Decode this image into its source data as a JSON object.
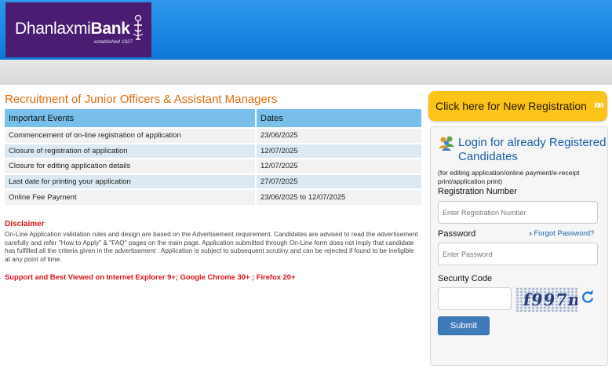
{
  "header": {
    "logo_name_light": "Dhanlaxmi",
    "logo_name_bold": "Bank",
    "logo_tagline": "established 1927",
    "bg_color": "#1a86e2",
    "logo_bg": "#4a1d73"
  },
  "main": {
    "title": "Recruitment of Junior Officers & Assistant Managers",
    "table": {
      "headers": [
        "Important Events",
        "Dates"
      ],
      "rows": [
        [
          "Commencement of on-line registration of application",
          "23/06/2025"
        ],
        [
          "Closure of registration of application",
          "12/07/2025"
        ],
        [
          "Closure for editing application details",
          "12/07/2025"
        ],
        [
          "Last date for printing your application",
          "27/07/2025"
        ],
        [
          "Online Fee Payment",
          "23/06/2025 to 12/07/2025"
        ]
      ]
    },
    "disclaimer_title": "Disclaimer",
    "disclaimer_text": "On-Line Application validation rules and design are based on the Advertisement requirement. Candidates are advised to read the advertisement carefully and refer \"How to Apply\" & \"FAQ\" pages on the main page. Application submitted through On-Line form does not imply that candidate has fulfilled all the criteria given in the advertisement . Application is subject to subsequent scrutiny and can be rejected if found to be ineligible at any point of time.",
    "support_text": "Support and Best Viewed on Internet Explorer 9+; Google Chrome 30+ ; Firefox 20+"
  },
  "sidebar": {
    "new_registration_label": "Click here for New Registration",
    "login_title": "Login for already Registered Candidates",
    "login_note": "(for editing application/online payment/e-receipt print/application print)",
    "registration_label": "Registration Number",
    "registration_placeholder": "Enter Registration Number",
    "password_label": "Password",
    "password_placeholder": "Enter Password",
    "forgot_label": "Forgot Password?",
    "security_label": "Security Code",
    "captcha_text": "f997n",
    "submit_label": "Submit",
    "accent_color": "#fcc419",
    "link_color": "#1b5fa8"
  },
  "icons": [
    "users-icon",
    "refresh-icon",
    "chevron-right-icon",
    "bank-emblem-icon"
  ]
}
